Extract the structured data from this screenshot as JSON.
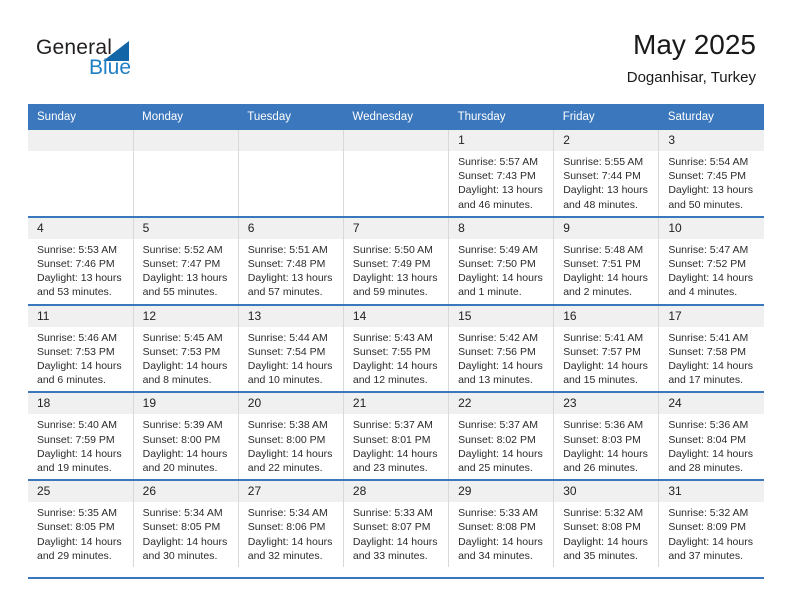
{
  "brand": {
    "name_dark": "General",
    "name_light": "Blue",
    "accent_color": "#1266a8",
    "logo_blue": "#1f7fc4"
  },
  "header": {
    "title": "May 2025",
    "subtitle": "Doganhisar, Turkey",
    "header_bg": "#3b77bc",
    "daynum_bg": "#f0f0f0"
  },
  "weekday_headers": [
    "Sunday",
    "Monday",
    "Tuesday",
    "Wednesday",
    "Thursday",
    "Friday",
    "Saturday"
  ],
  "weeks": [
    [
      {
        "day": "",
        "sunrise": "",
        "sunset": "",
        "daylight_line1": "",
        "daylight_line2": "",
        "empty": true
      },
      {
        "day": "",
        "sunrise": "",
        "sunset": "",
        "daylight_line1": "",
        "daylight_line2": "",
        "empty": true
      },
      {
        "day": "",
        "sunrise": "",
        "sunset": "",
        "daylight_line1": "",
        "daylight_line2": "",
        "empty": true
      },
      {
        "day": "",
        "sunrise": "",
        "sunset": "",
        "daylight_line1": "",
        "daylight_line2": "",
        "empty": true
      },
      {
        "day": "1",
        "sunrise": "Sunrise: 5:57 AM",
        "sunset": "Sunset: 7:43 PM",
        "daylight_line1": "Daylight: 13 hours",
        "daylight_line2": "and 46 minutes."
      },
      {
        "day": "2",
        "sunrise": "Sunrise: 5:55 AM",
        "sunset": "Sunset: 7:44 PM",
        "daylight_line1": "Daylight: 13 hours",
        "daylight_line2": "and 48 minutes."
      },
      {
        "day": "3",
        "sunrise": "Sunrise: 5:54 AM",
        "sunset": "Sunset: 7:45 PM",
        "daylight_line1": "Daylight: 13 hours",
        "daylight_line2": "and 50 minutes."
      }
    ],
    [
      {
        "day": "4",
        "sunrise": "Sunrise: 5:53 AM",
        "sunset": "Sunset: 7:46 PM",
        "daylight_line1": "Daylight: 13 hours",
        "daylight_line2": "and 53 minutes."
      },
      {
        "day": "5",
        "sunrise": "Sunrise: 5:52 AM",
        "sunset": "Sunset: 7:47 PM",
        "daylight_line1": "Daylight: 13 hours",
        "daylight_line2": "and 55 minutes."
      },
      {
        "day": "6",
        "sunrise": "Sunrise: 5:51 AM",
        "sunset": "Sunset: 7:48 PM",
        "daylight_line1": "Daylight: 13 hours",
        "daylight_line2": "and 57 minutes."
      },
      {
        "day": "7",
        "sunrise": "Sunrise: 5:50 AM",
        "sunset": "Sunset: 7:49 PM",
        "daylight_line1": "Daylight: 13 hours",
        "daylight_line2": "and 59 minutes."
      },
      {
        "day": "8",
        "sunrise": "Sunrise: 5:49 AM",
        "sunset": "Sunset: 7:50 PM",
        "daylight_line1": "Daylight: 14 hours",
        "daylight_line2": "and 1 minute."
      },
      {
        "day": "9",
        "sunrise": "Sunrise: 5:48 AM",
        "sunset": "Sunset: 7:51 PM",
        "daylight_line1": "Daylight: 14 hours",
        "daylight_line2": "and 2 minutes."
      },
      {
        "day": "10",
        "sunrise": "Sunrise: 5:47 AM",
        "sunset": "Sunset: 7:52 PM",
        "daylight_line1": "Daylight: 14 hours",
        "daylight_line2": "and 4 minutes."
      }
    ],
    [
      {
        "day": "11",
        "sunrise": "Sunrise: 5:46 AM",
        "sunset": "Sunset: 7:53 PM",
        "daylight_line1": "Daylight: 14 hours",
        "daylight_line2": "and 6 minutes."
      },
      {
        "day": "12",
        "sunrise": "Sunrise: 5:45 AM",
        "sunset": "Sunset: 7:53 PM",
        "daylight_line1": "Daylight: 14 hours",
        "daylight_line2": "and 8 minutes."
      },
      {
        "day": "13",
        "sunrise": "Sunrise: 5:44 AM",
        "sunset": "Sunset: 7:54 PM",
        "daylight_line1": "Daylight: 14 hours",
        "daylight_line2": "and 10 minutes."
      },
      {
        "day": "14",
        "sunrise": "Sunrise: 5:43 AM",
        "sunset": "Sunset: 7:55 PM",
        "daylight_line1": "Daylight: 14 hours",
        "daylight_line2": "and 12 minutes."
      },
      {
        "day": "15",
        "sunrise": "Sunrise: 5:42 AM",
        "sunset": "Sunset: 7:56 PM",
        "daylight_line1": "Daylight: 14 hours",
        "daylight_line2": "and 13 minutes."
      },
      {
        "day": "16",
        "sunrise": "Sunrise: 5:41 AM",
        "sunset": "Sunset: 7:57 PM",
        "daylight_line1": "Daylight: 14 hours",
        "daylight_line2": "and 15 minutes."
      },
      {
        "day": "17",
        "sunrise": "Sunrise: 5:41 AM",
        "sunset": "Sunset: 7:58 PM",
        "daylight_line1": "Daylight: 14 hours",
        "daylight_line2": "and 17 minutes."
      }
    ],
    [
      {
        "day": "18",
        "sunrise": "Sunrise: 5:40 AM",
        "sunset": "Sunset: 7:59 PM",
        "daylight_line1": "Daylight: 14 hours",
        "daylight_line2": "and 19 minutes."
      },
      {
        "day": "19",
        "sunrise": "Sunrise: 5:39 AM",
        "sunset": "Sunset: 8:00 PM",
        "daylight_line1": "Daylight: 14 hours",
        "daylight_line2": "and 20 minutes."
      },
      {
        "day": "20",
        "sunrise": "Sunrise: 5:38 AM",
        "sunset": "Sunset: 8:00 PM",
        "daylight_line1": "Daylight: 14 hours",
        "daylight_line2": "and 22 minutes."
      },
      {
        "day": "21",
        "sunrise": "Sunrise: 5:37 AM",
        "sunset": "Sunset: 8:01 PM",
        "daylight_line1": "Daylight: 14 hours",
        "daylight_line2": "and 23 minutes."
      },
      {
        "day": "22",
        "sunrise": "Sunrise: 5:37 AM",
        "sunset": "Sunset: 8:02 PM",
        "daylight_line1": "Daylight: 14 hours",
        "daylight_line2": "and 25 minutes."
      },
      {
        "day": "23",
        "sunrise": "Sunrise: 5:36 AM",
        "sunset": "Sunset: 8:03 PM",
        "daylight_line1": "Daylight: 14 hours",
        "daylight_line2": "and 26 minutes."
      },
      {
        "day": "24",
        "sunrise": "Sunrise: 5:36 AM",
        "sunset": "Sunset: 8:04 PM",
        "daylight_line1": "Daylight: 14 hours",
        "daylight_line2": "and 28 minutes."
      }
    ],
    [
      {
        "day": "25",
        "sunrise": "Sunrise: 5:35 AM",
        "sunset": "Sunset: 8:05 PM",
        "daylight_line1": "Daylight: 14 hours",
        "daylight_line2": "and 29 minutes."
      },
      {
        "day": "26",
        "sunrise": "Sunrise: 5:34 AM",
        "sunset": "Sunset: 8:05 PM",
        "daylight_line1": "Daylight: 14 hours",
        "daylight_line2": "and 30 minutes."
      },
      {
        "day": "27",
        "sunrise": "Sunrise: 5:34 AM",
        "sunset": "Sunset: 8:06 PM",
        "daylight_line1": "Daylight: 14 hours",
        "daylight_line2": "and 32 minutes."
      },
      {
        "day": "28",
        "sunrise": "Sunrise: 5:33 AM",
        "sunset": "Sunset: 8:07 PM",
        "daylight_line1": "Daylight: 14 hours",
        "daylight_line2": "and 33 minutes."
      },
      {
        "day": "29",
        "sunrise": "Sunrise: 5:33 AM",
        "sunset": "Sunset: 8:08 PM",
        "daylight_line1": "Daylight: 14 hours",
        "daylight_line2": "and 34 minutes."
      },
      {
        "day": "30",
        "sunrise": "Sunrise: 5:32 AM",
        "sunset": "Sunset: 8:08 PM",
        "daylight_line1": "Daylight: 14 hours",
        "daylight_line2": "and 35 minutes."
      },
      {
        "day": "31",
        "sunrise": "Sunrise: 5:32 AM",
        "sunset": "Sunset: 8:09 PM",
        "daylight_line1": "Daylight: 14 hours",
        "daylight_line2": "and 37 minutes."
      }
    ]
  ]
}
